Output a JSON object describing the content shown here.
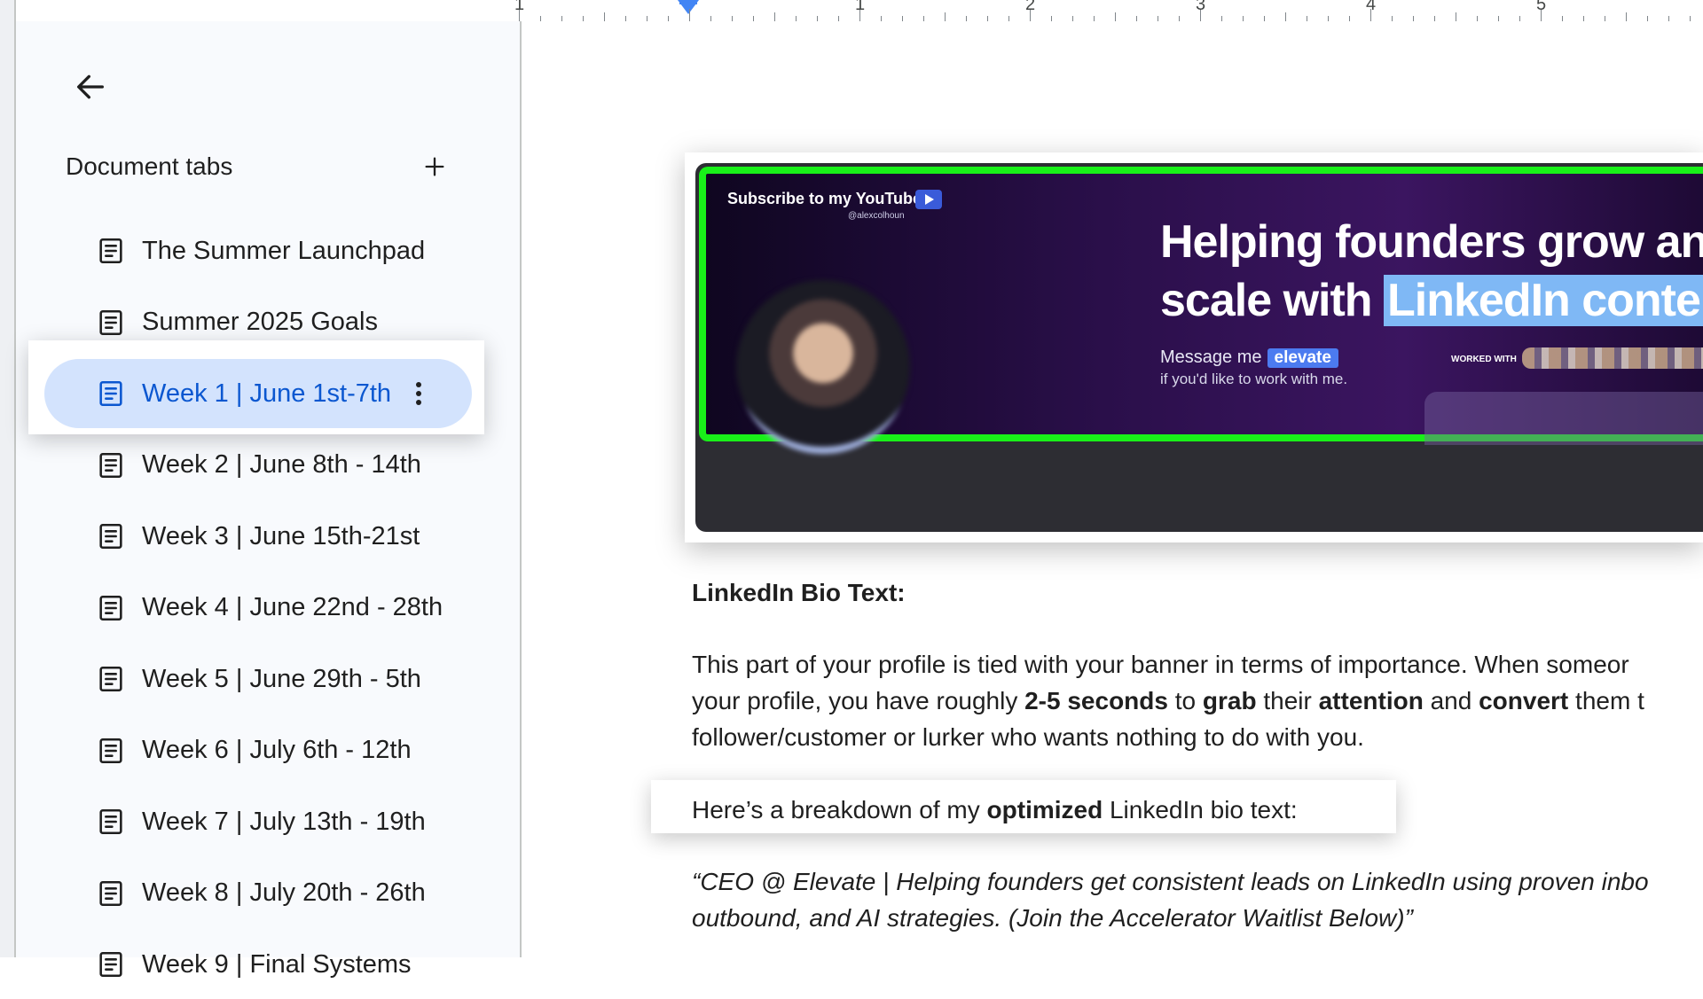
{
  "ruler": {
    "numbers": [
      "1",
      "1",
      "2",
      "3",
      "4",
      "5"
    ]
  },
  "sidebar": {
    "back_icon": "arrow-left-icon",
    "header": {
      "title": "Document tabs",
      "add_icon": "plus-icon"
    },
    "tabs": [
      {
        "label": "The Summer Launchpad",
        "icon": "document-icon"
      },
      {
        "label": "Summer 2025 Goals",
        "icon": "document-icon"
      },
      {
        "label": "Week 1 | June 1st-7th",
        "icon": "document-icon",
        "active": true,
        "more_icon": "more-vert-icon"
      },
      {
        "label": "Week 2 | June 8th - 14th",
        "icon": "document-icon"
      },
      {
        "label": "Week 3 | June 15th-21st",
        "icon": "document-icon"
      },
      {
        "label": "Week 4 | June 22nd - 28th",
        "icon": "document-icon"
      },
      {
        "label": "Week 5 | June 29th - 5th",
        "icon": "document-icon"
      },
      {
        "label": "Week 6 | July 6th - 12th",
        "icon": "document-icon"
      },
      {
        "label": "Week 7 | July 13th - 19th",
        "icon": "document-icon"
      },
      {
        "label": "Week 8 | July 20th - 26th",
        "icon": "document-icon"
      },
      {
        "label": "Week 9 | Final Systems",
        "icon": "document-icon"
      }
    ]
  },
  "banner": {
    "subscribe": "Subscribe to my YouTube",
    "handle": "@alexcolhoun",
    "headline_line1": "Helping founders grow an",
    "headline_line2_a": "scale with ",
    "headline_line2_b": "LinkedIn conte",
    "message": "Message me",
    "elevate": "elevate",
    "message_sub": "if you'd like to work with me.",
    "worked_with": "WORKED WITH",
    "colors": {
      "border": "#19f019",
      "bg_start": "#0f0620",
      "bg_end": "#3b1560"
    }
  },
  "document": {
    "heading": "LinkedIn Bio Text:",
    "para1_line1": "This part of your profile is tied with your banner in terms of importance. When someor",
    "para1_line2_a": "your profile, you have roughly ",
    "para1_line2_b": "2-5 seconds",
    "para1_line2_c": " to ",
    "para1_line2_d": "grab",
    "para1_line2_e": " their ",
    "para1_line2_f": "attention",
    "para1_line2_g": " and ",
    "para1_line2_h": "convert",
    "para1_line2_i": " them t",
    "para1_line3": "follower/customer or lurker who wants nothing to do with you.",
    "breakdown_a": "Here’s a breakdown of my ",
    "breakdown_b": "optimized",
    "breakdown_c": " LinkedIn bio text:",
    "quote_line1": "“CEO @ Elevate | Helping founders get consistent leads on LinkedIn using proven inbo",
    "quote_line2": "outbound, and AI strategies. (Join the Accelerator Waitlist Below)”"
  }
}
